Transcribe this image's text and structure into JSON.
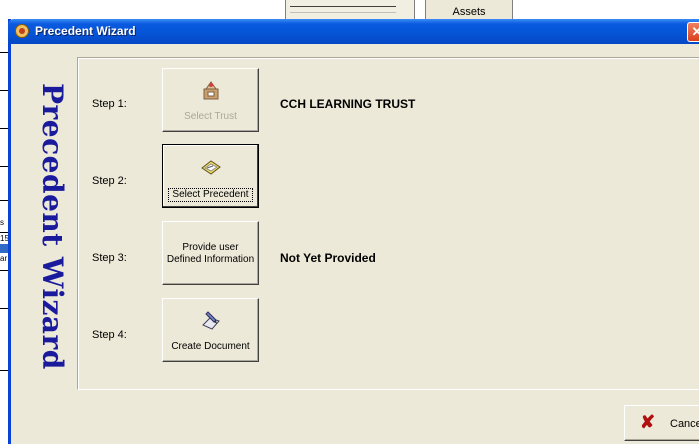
{
  "background": {
    "assets_tab": "Assets",
    "fragments": [
      "s",
      "15",
      "ar"
    ]
  },
  "window": {
    "title": "Precedent Wizard",
    "close_label": "✕",
    "side_title": "Precedent Wizard"
  },
  "steps": [
    {
      "label": "Step 1:",
      "button": "Select Trust",
      "value": "CCH LEARNING TRUST",
      "icon": "trust-icon",
      "enabled": false
    },
    {
      "label": "Step 2:",
      "button": "Select Precedent",
      "value": "",
      "icon": "precedent-icon",
      "enabled": true
    },
    {
      "label": "Step 3:",
      "button": "Provide user Defined Information",
      "value": "Not Yet Provided",
      "icon": "",
      "enabled": true
    },
    {
      "label": "Step 4:",
      "button": "Create Document",
      "value": "",
      "icon": "create-document-icon",
      "enabled": true
    }
  ],
  "footer": {
    "cancel_label": "Cancel"
  }
}
